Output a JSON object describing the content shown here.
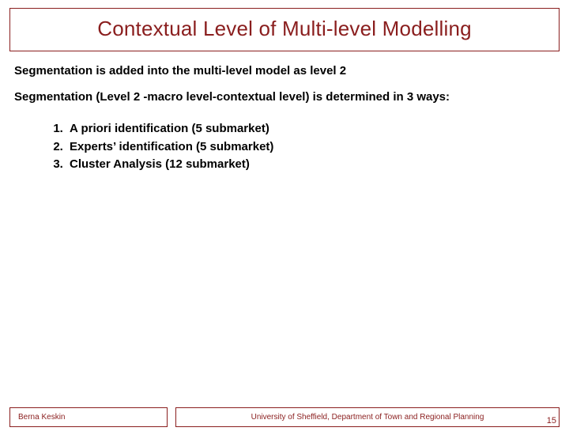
{
  "title": "Contextual Level of Multi-level Modelling",
  "paragraphs": {
    "p1": "Segmentation is added into the multi-level model as level 2",
    "p2": "Segmentation (Level 2 -macro level-contextual level) is determined in 3 ways:"
  },
  "list": {
    "item1": "A priori identification (5 submarket)",
    "item2": "Experts’ identification (5 submarket)",
    "item3": "Cluster Analysis (12 submarket)"
  },
  "footer": {
    "author": "Berna Keskin",
    "affiliation": "University of Sheffield, Department of Town and Regional Planning",
    "page": "15"
  },
  "colors": {
    "accent": "#8a1e1e"
  }
}
